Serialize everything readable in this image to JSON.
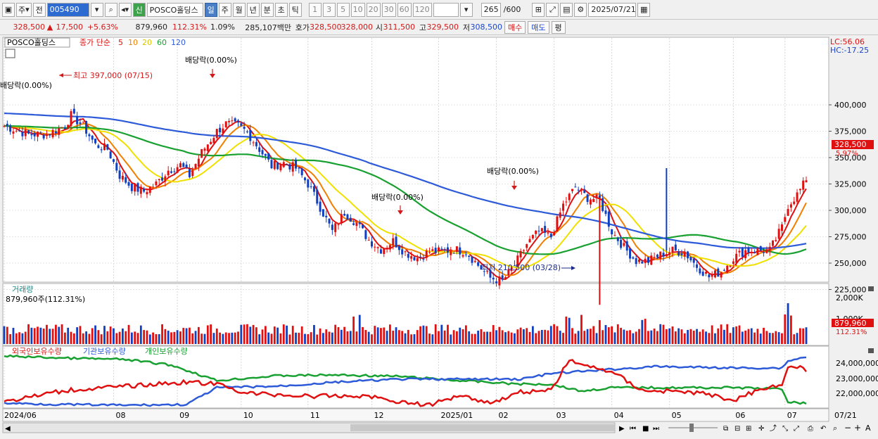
{
  "toolbar": {
    "market": "주",
    "type": "전",
    "code": "005490",
    "name": "POSCO홀딩스",
    "credit": "신",
    "periods": [
      "일",
      "주",
      "월",
      "년",
      "분",
      "초",
      "틱"
    ],
    "intervals": [
      "1",
      "3",
      "5",
      "10",
      "20",
      "30",
      "60",
      "120"
    ],
    "count": "265",
    "count_total": "/600",
    "date": "2025/07/21"
  },
  "quote": {
    "price": "328,500",
    "change": "17,500",
    "change_pct": "+5.63%",
    "volume": "879,960",
    "volume_ratio": "112.31%",
    "turnover": "1.09%",
    "amount": "285,107백만",
    "ask_label": "호가",
    "ask": "328,500",
    "bid": "328,000",
    "open_label": "시",
    "open": "311,500",
    "high_label": "고",
    "high": "329,500",
    "low_label": "저",
    "low": "308,500",
    "buy": "매수",
    "sell": "매도",
    "eval": "평"
  },
  "price_panel": {
    "tab": "POSCO홀딩스",
    "ma_label": "종가 단순",
    "ma_periods": [
      "5",
      "10",
      "20",
      "60",
      "120"
    ],
    "lc": "LC:56.06",
    "hc": "HC:-17.25",
    "high_label": "최고 397,000 (07/15)",
    "low_label": "최저 210,500 (03/28)",
    "dividend": "배당락(0.00%)",
    "price_tag": "328,500",
    "price_tag_pct": "5.97%",
    "y_ticks": [
      "400,000",
      "375,000",
      "350,000",
      "325,000",
      "300,000",
      "275,000",
      "250,000",
      "225,000"
    ]
  },
  "volume_panel": {
    "title": "거래량",
    "value": "879,960주(112.31%)",
    "y_ticks": [
      "2,000K",
      "1,000K"
    ],
    "tag": "879,960",
    "tag_pct": "112.31%"
  },
  "holding_panel": {
    "series": [
      "외국인보유수량",
      "기관보유수량",
      "개인보유수량"
    ],
    "y_ticks": [
      "24,000,000",
      "23,000,000",
      "22,000,000"
    ]
  },
  "x_axis": [
    "2024/06",
    "08",
    "09",
    "10",
    "11",
    "12",
    "2025/01",
    "02",
    "03",
    "04",
    "05",
    "06",
    "07",
    "07/21"
  ],
  "colors": {
    "ma5": "#e01010",
    "ma10": "#f08000",
    "ma20": "#f0e000",
    "ma60": "#18a030",
    "ma120": "#2d5ad8",
    "up": "#e01010",
    "down": "#1040c0"
  }
}
